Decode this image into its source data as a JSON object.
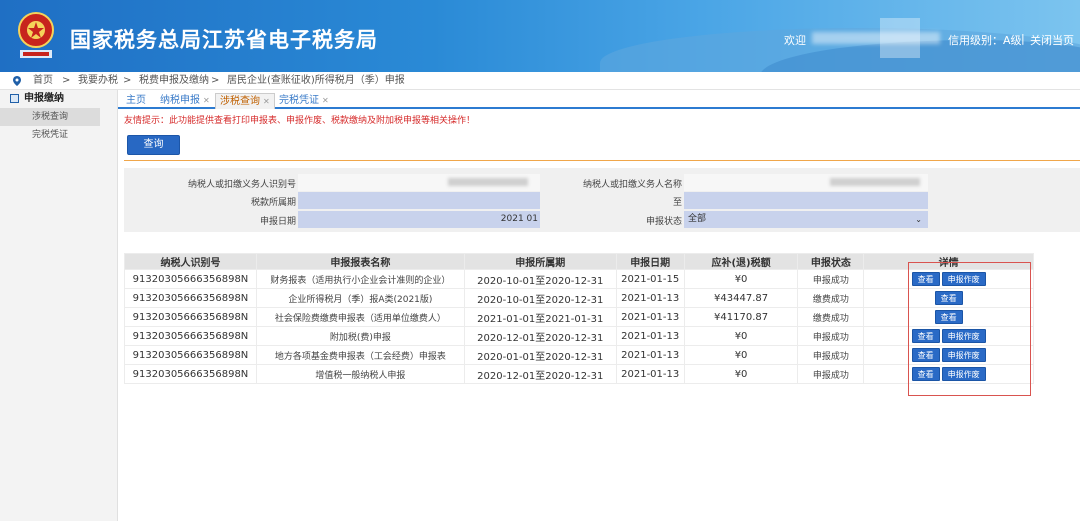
{
  "header": {
    "title": "国家税务总局江苏省电子税务局",
    "welcome": "欢迎",
    "credit_rating": "信用级别：A级",
    "separator": "|",
    "close_page": "关闭当页"
  },
  "breadcrumb": [
    "首页",
    ">",
    "我要办税",
    ">",
    "税费申报及缴纳",
    ">",
    "居民企业(查账征收)所得税月（季）申报"
  ],
  "sidebar": {
    "title": "申报缴纳",
    "items": [
      {
        "label": "涉税查询"
      },
      {
        "label": "完税凭证"
      }
    ]
  },
  "tabs": [
    {
      "label": "主页"
    },
    {
      "label": "纳税申报"
    },
    {
      "label": "涉税查询"
    },
    {
      "label": "完税凭证"
    }
  ],
  "notice": "友情提示：此功能提供查看打印申报表、申报作废、税款缴纳及附加税申报等相关操作！",
  "query_button": "查询",
  "form": {
    "taxpayer_id_label": "纳税人或扣缴义务人识别号",
    "taxpayer_name_label": "纳税人或扣缴义务人名称",
    "tax_period_label": "税款所属期",
    "to_label": "至",
    "declare_date_label": "申报日期",
    "declare_date_value": "2021 01",
    "declare_status_label": "申报状态",
    "declare_status_value": "全部"
  },
  "table": {
    "headers": [
      "纳税人识别号",
      "申报报表名称",
      "申报所属期",
      "申报日期",
      "应补(退)税额",
      "申报状态",
      "详情"
    ],
    "rows": [
      {
        "id": "91320305666356898N",
        "name": "财务报表（适用执行小企业会计准则的企业）",
        "period": "2020-10-01至2020-12-31",
        "date": "2021-01-15",
        "amount": "¥0",
        "status": "申报成功",
        "actions": [
          "查看",
          "申报作废"
        ]
      },
      {
        "id": "91320305666356898N",
        "name": "企业所得税月（季）报A类(2021版)",
        "period": "2020-10-01至2020-12-31",
        "date": "2021-01-13",
        "amount": "¥43447.87",
        "status": "缴费成功",
        "actions": [
          "查看"
        ]
      },
      {
        "id": "91320305666356898N",
        "name": "社会保险费缴费申报表（适用单位缴费人）",
        "period": "2021-01-01至2021-01-31",
        "date": "2021-01-13",
        "amount": "¥41170.87",
        "status": "缴费成功",
        "actions": [
          "查看"
        ]
      },
      {
        "id": "91320305666356898N",
        "name": "附加税(费)申报",
        "period": "2020-12-01至2020-12-31",
        "date": "2021-01-13",
        "amount": "¥0",
        "status": "申报成功",
        "actions": [
          "查看",
          "申报作废"
        ]
      },
      {
        "id": "91320305666356898N",
        "name": "地方各项基金费申报表（工会经费）申报表",
        "period": "2020-01-01至2020-12-31",
        "date": "2021-01-13",
        "amount": "¥0",
        "status": "申报成功",
        "actions": [
          "查看",
          "申报作废"
        ]
      },
      {
        "id": "91320305666356898N",
        "name": "增值税一般纳税人申报",
        "period": "2020-12-01至2020-12-31",
        "date": "2021-01-13",
        "amount": "¥0",
        "status": "申报成功",
        "actions": [
          "查看",
          "申报作废"
        ]
      }
    ]
  },
  "colors": {
    "brand_blue": "#2868c3",
    "header_blue": "#1f6fc4",
    "notice_red": "#d62b2b",
    "highlight_orange": "#f0a64a"
  },
  "icons": [
    "emblem-logo",
    "location-icon",
    "menu-icon",
    "close-icon"
  ]
}
